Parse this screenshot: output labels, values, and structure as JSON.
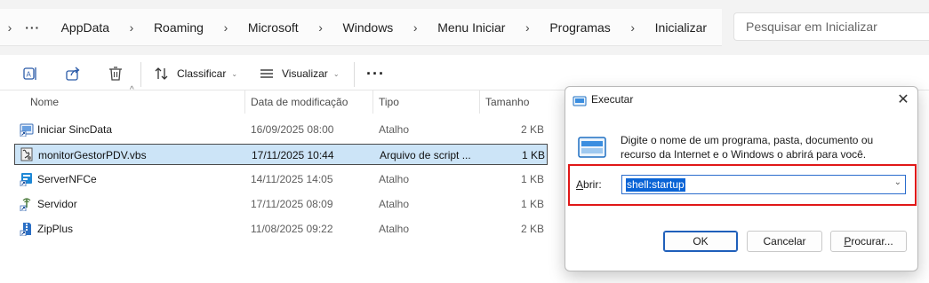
{
  "breadcrumb": {
    "more_label": "···",
    "items": [
      "AppData",
      "Roaming",
      "Microsoft",
      "Windows",
      "Menu Iniciar",
      "Programas",
      "Inicializar"
    ]
  },
  "search": {
    "placeholder": "Pesquisar em Inicializar"
  },
  "toolbar": {
    "sort_label": "Classificar",
    "view_label": "Visualizar",
    "more_label": "···",
    "icons": [
      "rename-icon",
      "share-icon",
      "delete-icon",
      "sort-icon",
      "view-icon",
      "more-icon"
    ]
  },
  "columns": {
    "name": "Nome",
    "date": "Data de modificação",
    "type": "Tipo",
    "size": "Tamanho"
  },
  "files": [
    {
      "name": "Iniciar SincData",
      "date": "16/09/2025 08:00",
      "type": "Atalho",
      "size": "2 KB",
      "icon": "shortcut-app-icon",
      "selected": false
    },
    {
      "name": "monitorGestorPDV.vbs",
      "date": "17/11/2025 10:44",
      "type": "Arquivo de script ...",
      "size": "1 KB",
      "icon": "vbs-script-icon",
      "selected": true
    },
    {
      "name": "ServerNFCe",
      "date": "14/11/2025 14:05",
      "type": "Atalho",
      "size": "1 KB",
      "icon": "shortcut-app-icon",
      "selected": false
    },
    {
      "name": "Servidor",
      "date": "17/11/2025 08:09",
      "type": "Atalho",
      "size": "1 KB",
      "icon": "shortcut-server-icon",
      "selected": false
    },
    {
      "name": "ZipPlus",
      "date": "11/08/2025 09:22",
      "type": "Atalho",
      "size": "2 KB",
      "icon": "shortcut-zip-icon",
      "selected": false
    }
  ],
  "run_dialog": {
    "title": "Executar",
    "close_label": "✕",
    "description": "Digite o nome de um programa, pasta, documento ou recurso da Internet e o Windows o abrirá para você.",
    "open_label_prefix": "",
    "open_label_accel": "A",
    "open_label_rest": "brir:",
    "open_value": "shell:startup",
    "ok_label": "OK",
    "cancel_label": "Cancelar",
    "browse_accel": "P",
    "browse_rest": "rocurar...",
    "highlight_color": "#e01818"
  }
}
